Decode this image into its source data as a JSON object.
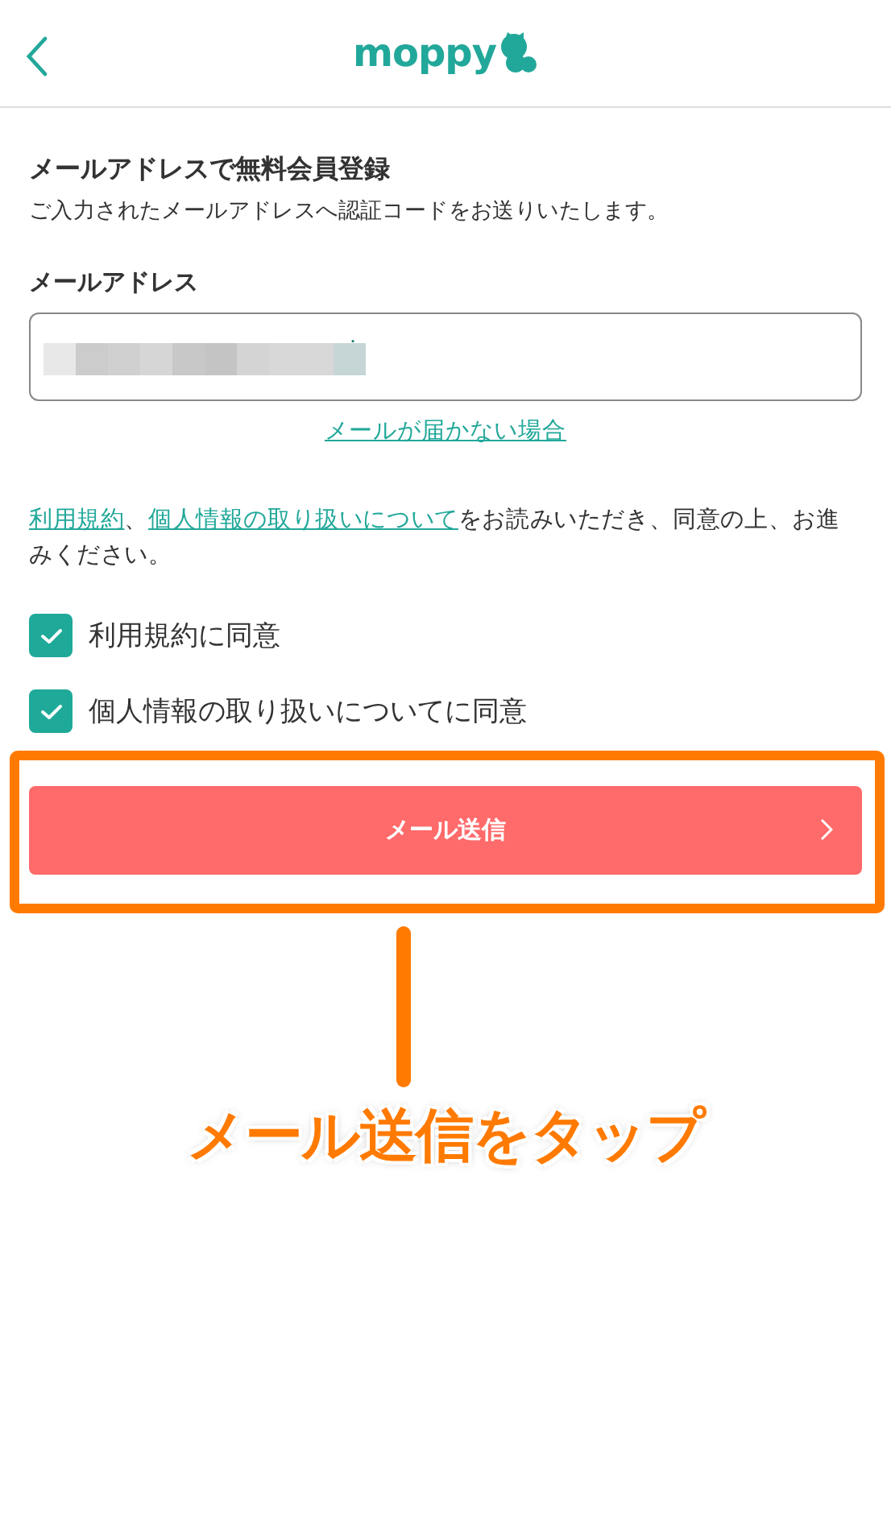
{
  "header": {
    "logo": "moppy"
  },
  "form": {
    "title": "メールアドレスで無料会員登録",
    "subtitle": "ご入力されたメールアドレスへ認証コードをお送りいたします。",
    "email_label": "メールアドレス",
    "email_value_redacted": true,
    "help_link": "メールが届かない場合"
  },
  "notice": [
    {
      "kind": "link",
      "text": "利用規約"
    },
    {
      "kind": "text",
      "text": "、"
    },
    {
      "kind": "link",
      "text": "個人情報の取り扱いについて"
    },
    {
      "kind": "text",
      "text": "をお読みいただき、同意の上、お進みください。"
    }
  ],
  "agreements": [
    {
      "label": "利用規約に同意",
      "checked": true
    },
    {
      "label": "個人情報の取り扱いについてに同意",
      "checked": true
    }
  ],
  "submit": {
    "label": "メール送信"
  },
  "annotation": {
    "caption": "メール送信をタップ"
  }
}
